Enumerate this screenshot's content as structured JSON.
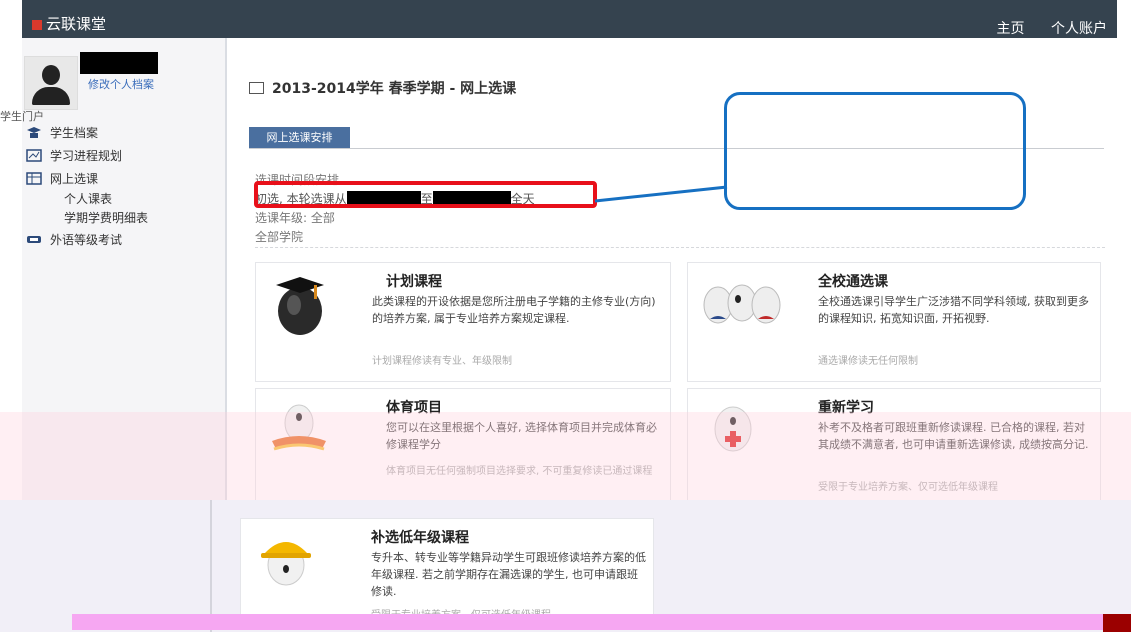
{
  "topbar": {
    "brand": "云联课堂",
    "home": "主页",
    "user_menu": "个人账户"
  },
  "sidebar": {
    "edit_profile": "修改个人档案",
    "portal": "学生门户",
    "items": [
      {
        "label": "学生档案",
        "icon": "student-profile-icon"
      },
      {
        "label": "学习进程规划",
        "icon": "study-plan-icon"
      },
      {
        "label": "网上选课",
        "icon": "online-course-icon"
      }
    ],
    "sub_items": [
      "个人课表",
      "学期学费明细表"
    ],
    "last_item": {
      "label": "外语等级考试",
      "icon": "exam-icon"
    }
  },
  "main": {
    "title": "2013-2014学年 春季学期 - 网上选课",
    "tab": "网上选课安排",
    "schedule_heading": "选课时间段安排",
    "schedule_prefix": "初选, 本轮选课从",
    "schedule_to": "至",
    "schedule_suffix": "全天",
    "grade": "选课年级: 全部",
    "college": "全部学院"
  },
  "cards": [
    {
      "title": "计划课程",
      "desc": "此类课程的开设依据是您所注册电子学籍的主修专业(方向)的培养方案, 属于专业培养方案规定课程.",
      "note": "计划课程修读有专业、年级限制"
    },
    {
      "title": "全校通选课",
      "desc": "全校通选课引导学生广泛涉猎不同学科领域, 获取到更多的课程知识, 拓宽知识面, 开拓视野.",
      "note": "通选课修读无任何限制"
    },
    {
      "title": "体育项目",
      "desc": "您可以在这里根据个人喜好, 选择体育项目并完成体育必修课程学分",
      "note": "体育项目无任何强制项目选择要求, 不可重复修读已通过课程"
    },
    {
      "title": "重新学习",
      "desc": "补考不及格者可跟班重新修读课程. 已合格的课程, 若对其成绩不满意者, 也可申请重新选课修读, 成绩按高分记.",
      "note": "受限于专业培养方案、仅可选低年级课程"
    },
    {
      "title": "补选低年级课程",
      "desc": "专升本、转专业等学籍异动学生可跟班修读培养方案的低年级课程. 若之前学期存在漏选课的学生, 也可申请跟班修读.",
      "note": "受限于专业培养方案、仅可选低年级课程"
    }
  ],
  "colors": {
    "topbar": "#35434f",
    "tab": "#4a6f9f",
    "highlight": "#e8101a",
    "callout": "#1670c2"
  }
}
